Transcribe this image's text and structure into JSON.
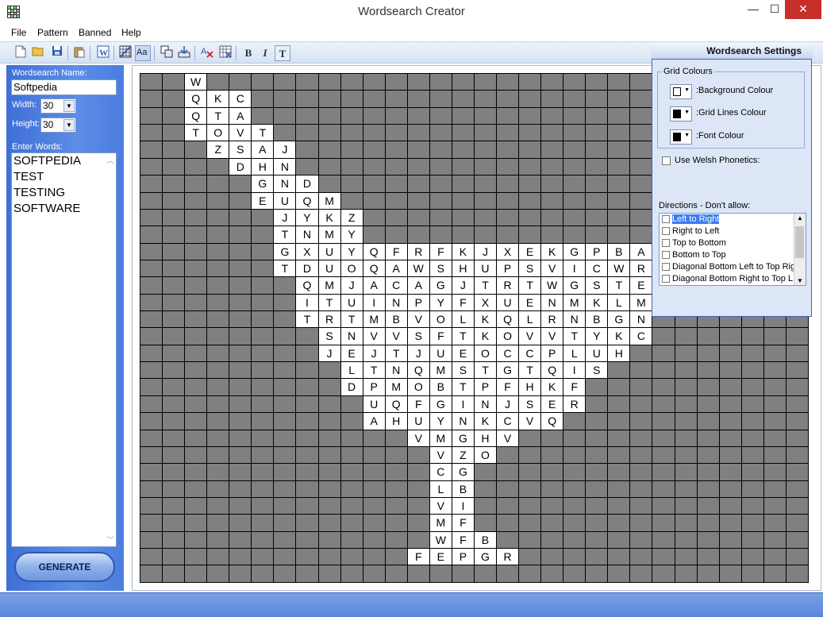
{
  "window": {
    "title": "Wordsearch Creator",
    "min": "—",
    "max": "☐",
    "close": "✕"
  },
  "menu": [
    "File",
    "Pattern",
    "Banned",
    "Help"
  ],
  "toolbar": {
    "bold": "B",
    "italic": "I",
    "text": "T"
  },
  "left": {
    "name_label": "Wordsearch Name:",
    "name_value": "Softpedia",
    "width_label": "Width:",
    "width_value": "30",
    "height_label": "Height:",
    "height_value": "30",
    "words_label": "Enter Words:",
    "words": [
      "SOFTPEDIA",
      "TEST",
      "TESTING",
      "SOFTWARE"
    ],
    "generate": "GENERATE"
  },
  "grid_rows": [
    "..W...........................",
    "..QKC.........................",
    "..QTA.........................",
    "..TOVT........................",
    "...ZSAJ...................RH..",
    "....DHN..................QHS..",
    ".....GND.................ODO..",
    ".....EUQM...............PAQF..",
    "......JYKZ..............ILXT..",
    "......TNMY.............DYQNW..",
    "......GXUYQFRFKJXEKGPBA.......",
    "......TDUOQAWSHUPSVICWR.......",
    ".......QMJACAGJTRTWGSTE.......",
    ".......ITUINPYFXUENMKLM.......",
    ".......TRTMBVOLKQLRNBGN.......",
    "........SNVVSFTKOVVTYKC.......",
    "........JEJTJUEOCCPLUH........",
    ".........LTNQMSTGTQIS.........",
    ".........DPMOBTPFHKF..........",
    "..........UQFGINJSER..........",
    "..........AHUYNKCVQ...........",
    "............VMGHV.............",
    ".............VZO..............",
    ".............CG...............",
    ".............LB...............",
    ".............VI...............",
    ".............MF...............",
    ".............WFB..............",
    "............FEPGR.............",
    ".............................."
  ],
  "settings": {
    "title": "Wordsearch Settings",
    "grid_colours_label": "Grid Colours",
    "background_label": ":Background Colour",
    "background_color": "#ffffff",
    "gridlines_label": ":Grid Lines Colour",
    "gridlines_color": "#000000",
    "font_label": ":Font Colour",
    "font_color": "#000000",
    "welsh_label": "Use Welsh Phonetics:",
    "directions_label": "Directions - Don't allow:",
    "directions": [
      "Left to Right",
      "Right to Left",
      "Top to Bottom",
      "Bottom to Top",
      "Diagonal Bottom Left to Top Rig",
      "Diagonal Bottom Right to Top L"
    ]
  }
}
